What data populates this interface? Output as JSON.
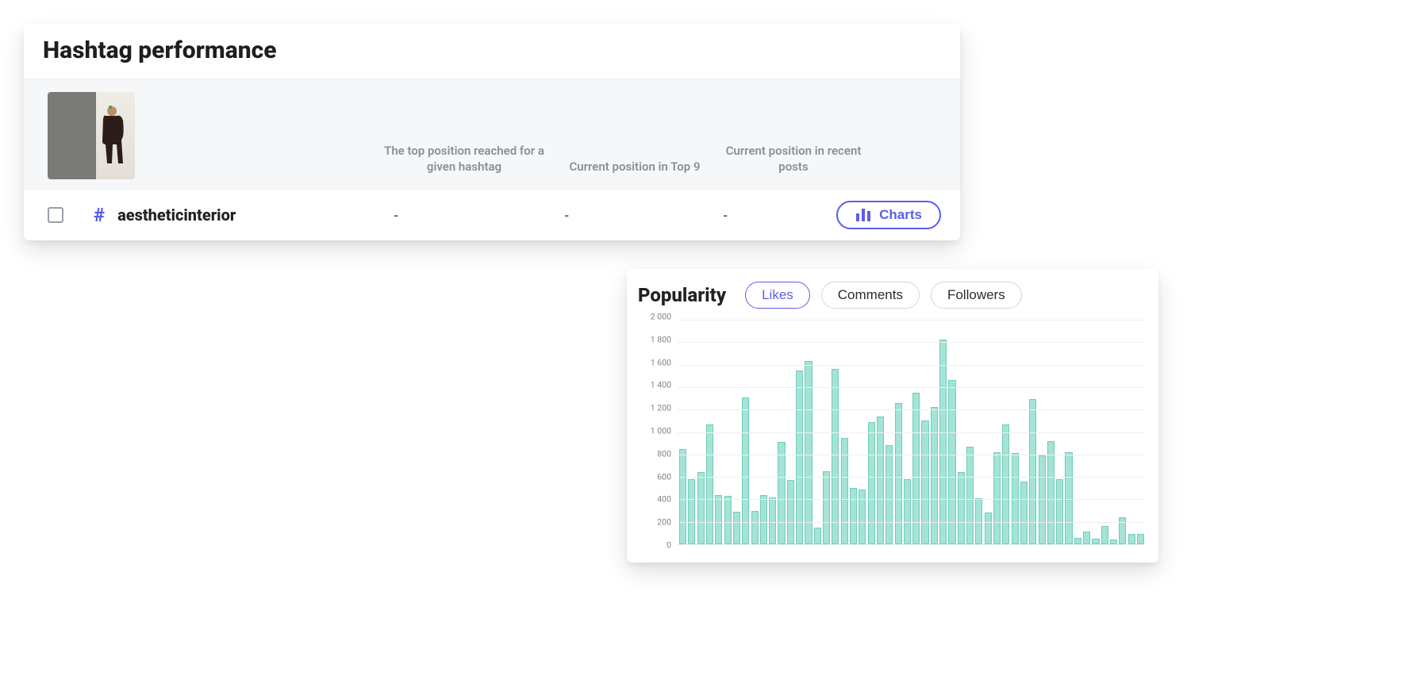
{
  "panel": {
    "title": "Hashtag performance",
    "columns": {
      "c1": "The top position reached for a given hashtag",
      "c2": "Current position in Top 9",
      "c3": "Current position in recent posts"
    },
    "row": {
      "hashSymbol": "#",
      "name": "aestheticinterior",
      "v1": "-",
      "v2": "-",
      "v3": "-",
      "chartsLabel": "Charts"
    }
  },
  "chart": {
    "title": "Popularity",
    "tabs": {
      "likes": "Likes",
      "comments": "Comments",
      "followers": "Followers"
    }
  },
  "chart_data": {
    "type": "bar",
    "title": "Popularity",
    "ylabel": "",
    "xlabel": "",
    "ylim": [
      0,
      2000
    ],
    "yticks": [
      0,
      200,
      400,
      600,
      800,
      1000,
      1200,
      1400,
      1600,
      1800,
      2000
    ],
    "ytick_labels": [
      "0",
      "200",
      "400",
      "600",
      "800",
      "1 000",
      "1 200",
      "1 400",
      "1 600",
      "1 800",
      "2 000"
    ],
    "values": [
      850,
      580,
      640,
      1070,
      440,
      430,
      290,
      1310,
      300,
      440,
      420,
      910,
      570,
      1550,
      1630,
      150,
      650,
      1560,
      950,
      500,
      490,
      1090,
      1140,
      880,
      1260,
      580,
      1350,
      1100,
      1220,
      1820,
      1460,
      640,
      870,
      410,
      280,
      820,
      1070,
      810,
      560,
      1290,
      790,
      920,
      580,
      820,
      60,
      110,
      50,
      160,
      40,
      240,
      90,
      90
    ]
  }
}
